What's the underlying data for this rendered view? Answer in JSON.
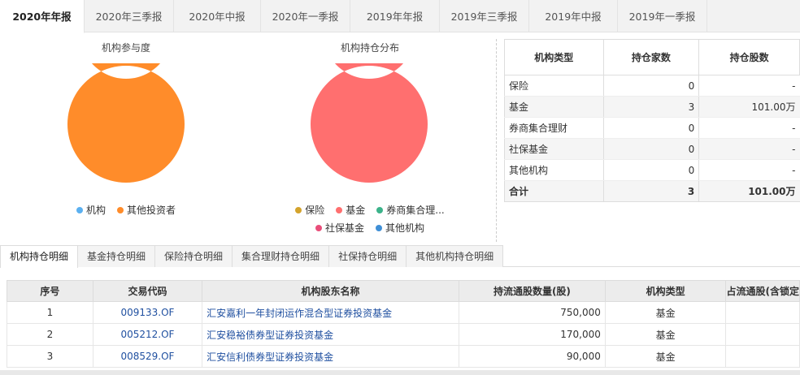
{
  "period_tabs": [
    {
      "label": "2020年年报",
      "active": true
    },
    {
      "label": "2020年三季报",
      "active": false
    },
    {
      "label": "2020年中报",
      "active": false
    },
    {
      "label": "2020年一季报",
      "active": false
    },
    {
      "label": "2019年年报",
      "active": false
    },
    {
      "label": "2019年三季报",
      "active": false
    },
    {
      "label": "2019年中报",
      "active": false
    },
    {
      "label": "2019年一季报",
      "active": false
    }
  ],
  "participation_chart": {
    "title": "机构参与度",
    "legend": [
      {
        "name": "机构",
        "color": "#5bb0f0"
      },
      {
        "name": "其他投资者",
        "color": "#ff8c2a"
      }
    ]
  },
  "distribution_chart": {
    "title": "机构持仓分布",
    "legend": [
      {
        "name": "保险",
        "color": "#d4a32c"
      },
      {
        "name": "基金",
        "color": "#ff6f6f"
      },
      {
        "name": "券商集合理...",
        "color": "#3cb38a"
      },
      {
        "name": "社保基金",
        "color": "#e94e7a"
      },
      {
        "name": "其他机构",
        "color": "#3f8fd6"
      }
    ]
  },
  "chart_data": [
    {
      "type": "pie",
      "title": "机构参与度",
      "categories": [
        "机构",
        "其他投资者"
      ],
      "values": [
        0,
        100
      ],
      "colors": [
        "#5bb0f0",
        "#ff8c2a"
      ]
    },
    {
      "type": "pie",
      "title": "机构持仓分布",
      "categories": [
        "保险",
        "基金",
        "券商集合理财",
        "社保基金",
        "其他机构"
      ],
      "values": [
        0,
        100,
        0,
        0,
        0
      ],
      "colors": [
        "#d4a32c",
        "#ff6f6f",
        "#3cb38a",
        "#e94e7a",
        "#3f8fd6"
      ]
    }
  ],
  "summary_table": {
    "headers": [
      "机构类型",
      "持仓家数",
      "持仓股数"
    ],
    "rows": [
      {
        "type": "保险",
        "count": "0",
        "shares": "-"
      },
      {
        "type": "基金",
        "count": "3",
        "shares": "101.00万"
      },
      {
        "type": "券商集合理财",
        "count": "0",
        "shares": "-"
      },
      {
        "type": "社保基金",
        "count": "0",
        "shares": "-"
      },
      {
        "type": "其他机构",
        "count": "0",
        "shares": "-"
      }
    ],
    "total": {
      "type": "合计",
      "count": "3",
      "shares": "101.00万"
    }
  },
  "detail_tabs": [
    {
      "label": "机构持仓明细",
      "active": true
    },
    {
      "label": "基金持仓明细",
      "active": false
    },
    {
      "label": "保险持仓明细",
      "active": false
    },
    {
      "label": "集合理财持仓明细",
      "active": false
    },
    {
      "label": "社保持仓明细",
      "active": false
    },
    {
      "label": "其他机构持仓明细",
      "active": false
    }
  ],
  "detail_table": {
    "headers": [
      "序号",
      "交易代码",
      "机构股东名称",
      "持流通股数量(股)",
      "机构类型",
      "占流通股(含锁定"
    ],
    "rows": [
      {
        "index": "1",
        "code": "009133.OF",
        "name": "汇安嘉利一年封闭运作混合型证券投资基金",
        "quantity": "750,000",
        "type": "基金",
        "ratio": ""
      },
      {
        "index": "2",
        "code": "005212.OF",
        "name": "汇安稳裕债券型证券投资基金",
        "quantity": "170,000",
        "type": "基金",
        "ratio": ""
      },
      {
        "index": "3",
        "code": "008529.OF",
        "name": "汇安信利债券型证券投资基金",
        "quantity": "90,000",
        "type": "基金",
        "ratio": ""
      }
    ]
  }
}
